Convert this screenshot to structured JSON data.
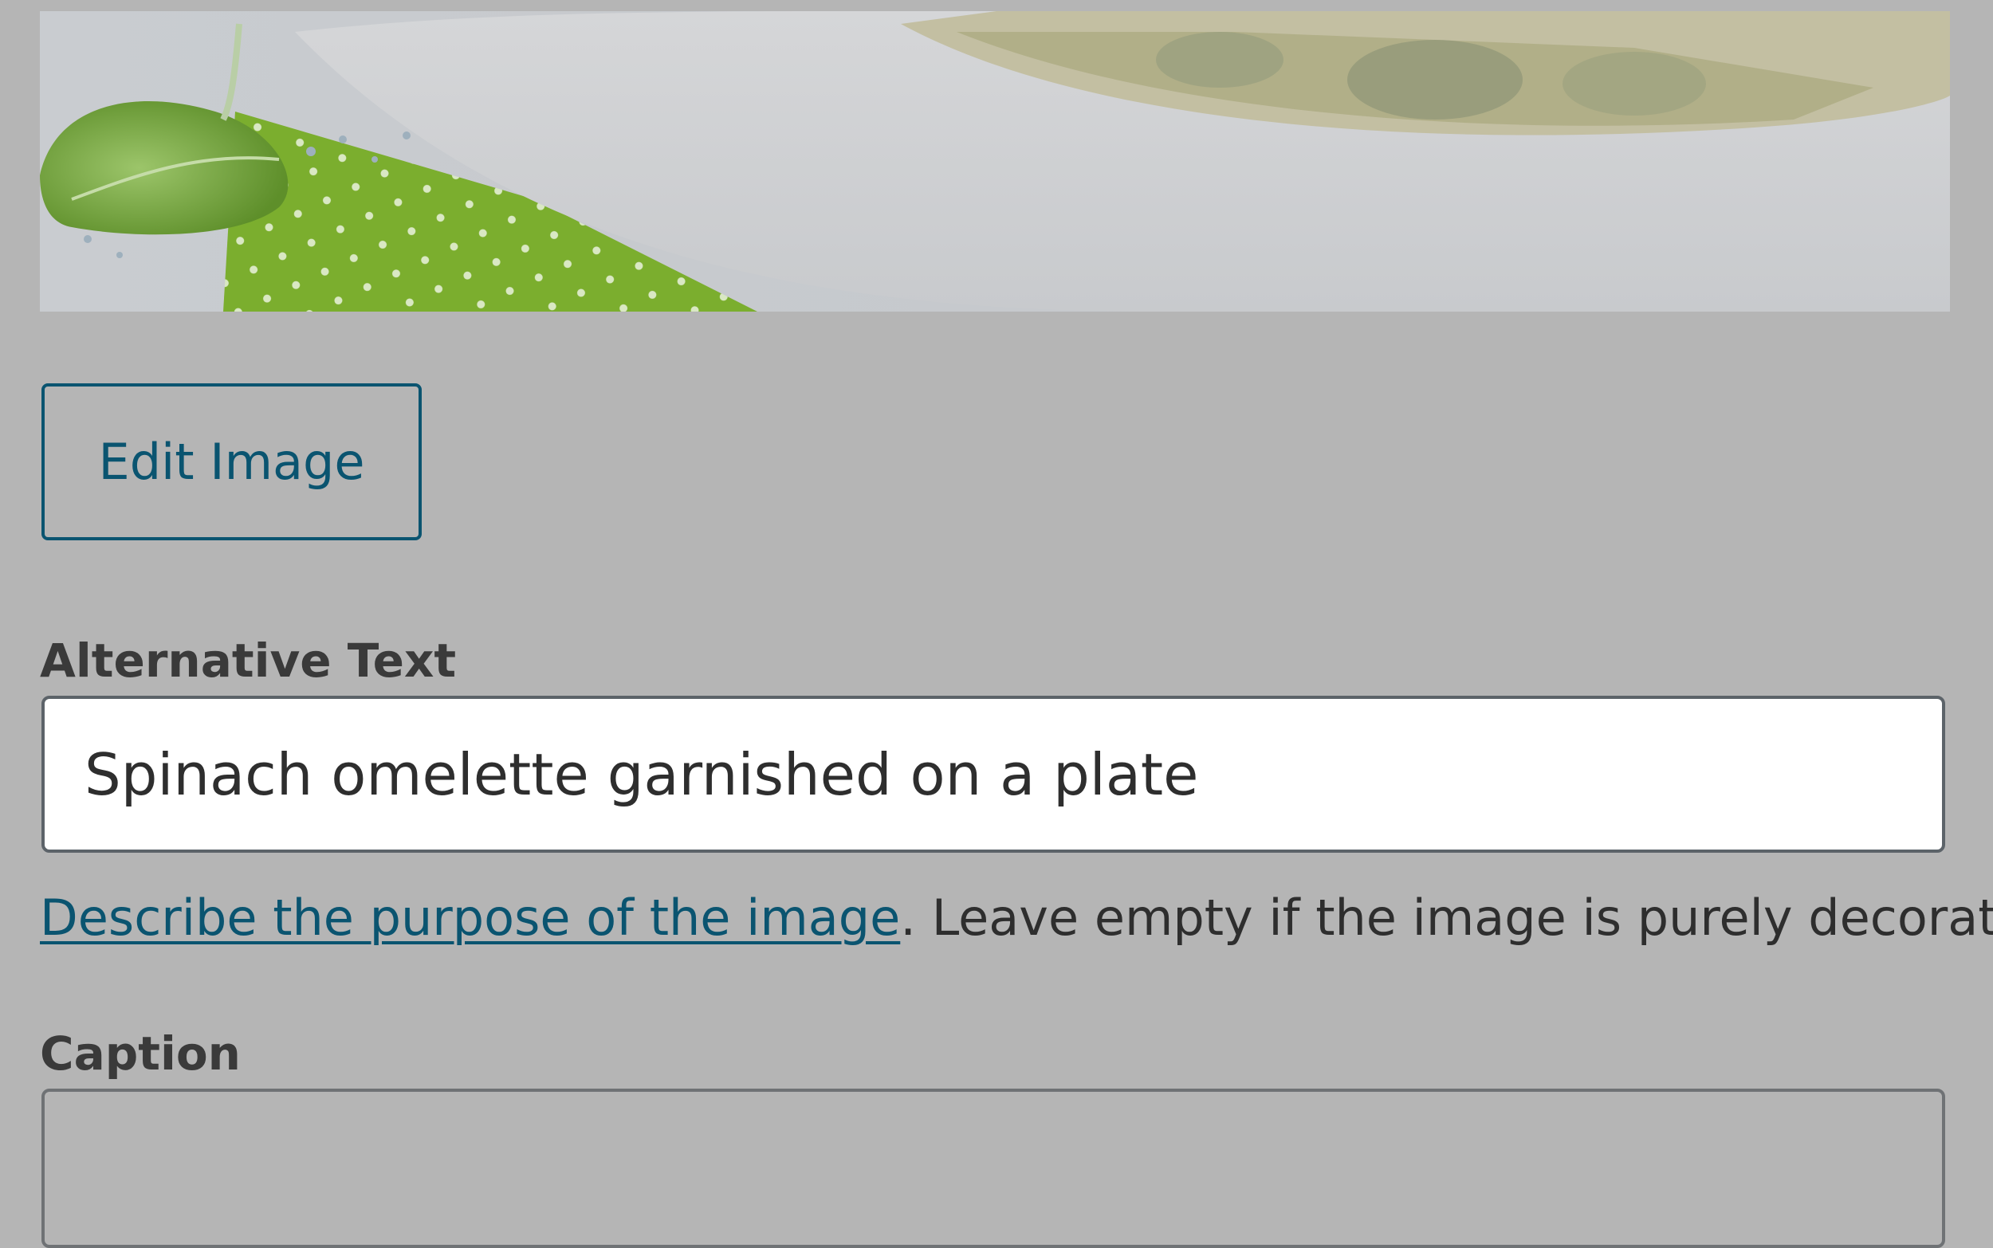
{
  "image_preview": {
    "alt": "Spinach omelette garnished on a plate"
  },
  "edit_button_label": "Edit Image",
  "alt_text": {
    "label": "Alternative Text",
    "value": "Spinach omelette garnished on a plate"
  },
  "help": {
    "link_text": "Describe the purpose of the image",
    "suffix": ". Leave empty if the image is purely decorative."
  },
  "caption": {
    "label": "Caption",
    "value": ""
  },
  "colors": {
    "overlay_background": "#b5b5b5",
    "accent": "#0a5470",
    "input_border": "#5c6369"
  }
}
